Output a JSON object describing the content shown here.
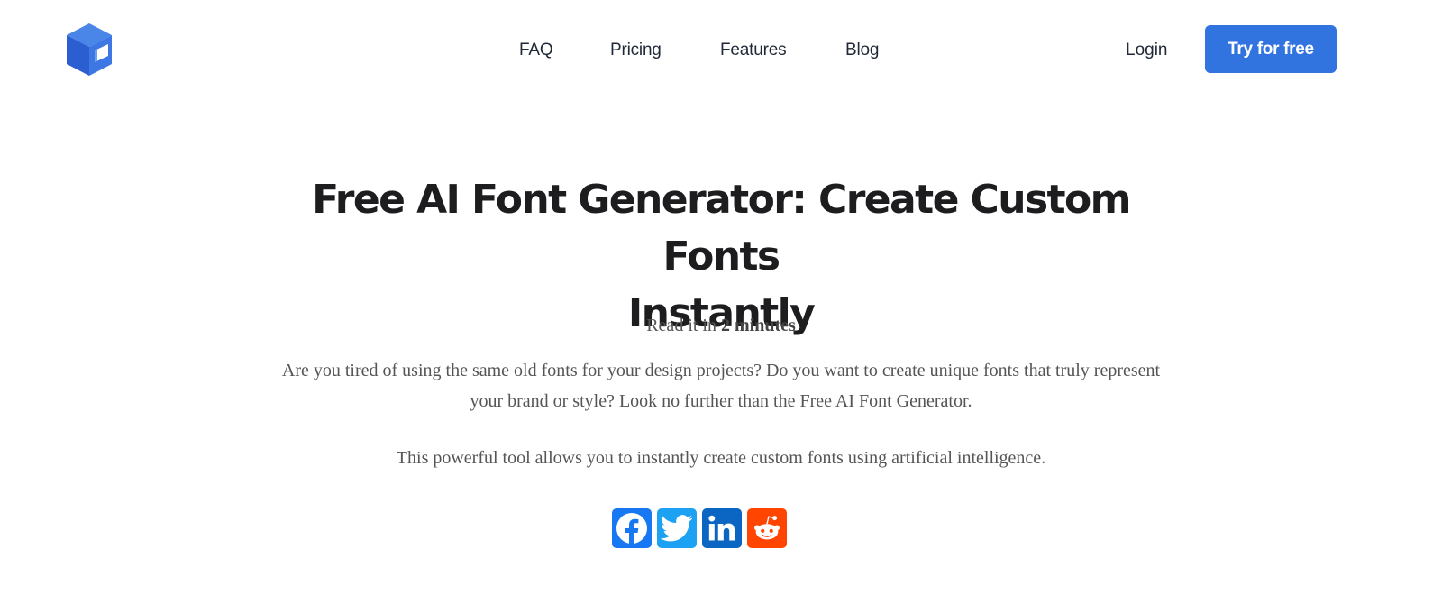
{
  "header": {
    "logo_name": "cube-logo",
    "nav": [
      {
        "label": "FAQ"
      },
      {
        "label": "Pricing"
      },
      {
        "label": "Features"
      },
      {
        "label": "Blog"
      }
    ],
    "login_label": "Login",
    "cta_label": "Try for free"
  },
  "hero": {
    "title_line1": "Free AI Font Generator: Create Custom Fonts",
    "title_line2": "Instantly",
    "readtime_prefix": "Read it in ",
    "readtime_value": "2 minutes",
    "paragraph1": "Are you tired of using the same old fonts for your design projects? Do you want to create unique fonts that truly represent your brand or style? Look no further than the Free AI Font Generator.",
    "paragraph2": "This powerful tool allows you to instantly create custom fonts using artificial intelligence."
  },
  "social": [
    {
      "name": "facebook",
      "color": "#1877f2"
    },
    {
      "name": "twitter",
      "color": "#1da1f2"
    },
    {
      "name": "linkedin",
      "color": "#0a66c2"
    },
    {
      "name": "reddit",
      "color": "#ff4500"
    }
  ],
  "colors": {
    "accent": "#3174e0",
    "text_dark": "#1d1d1f",
    "text_body": "#555555"
  }
}
